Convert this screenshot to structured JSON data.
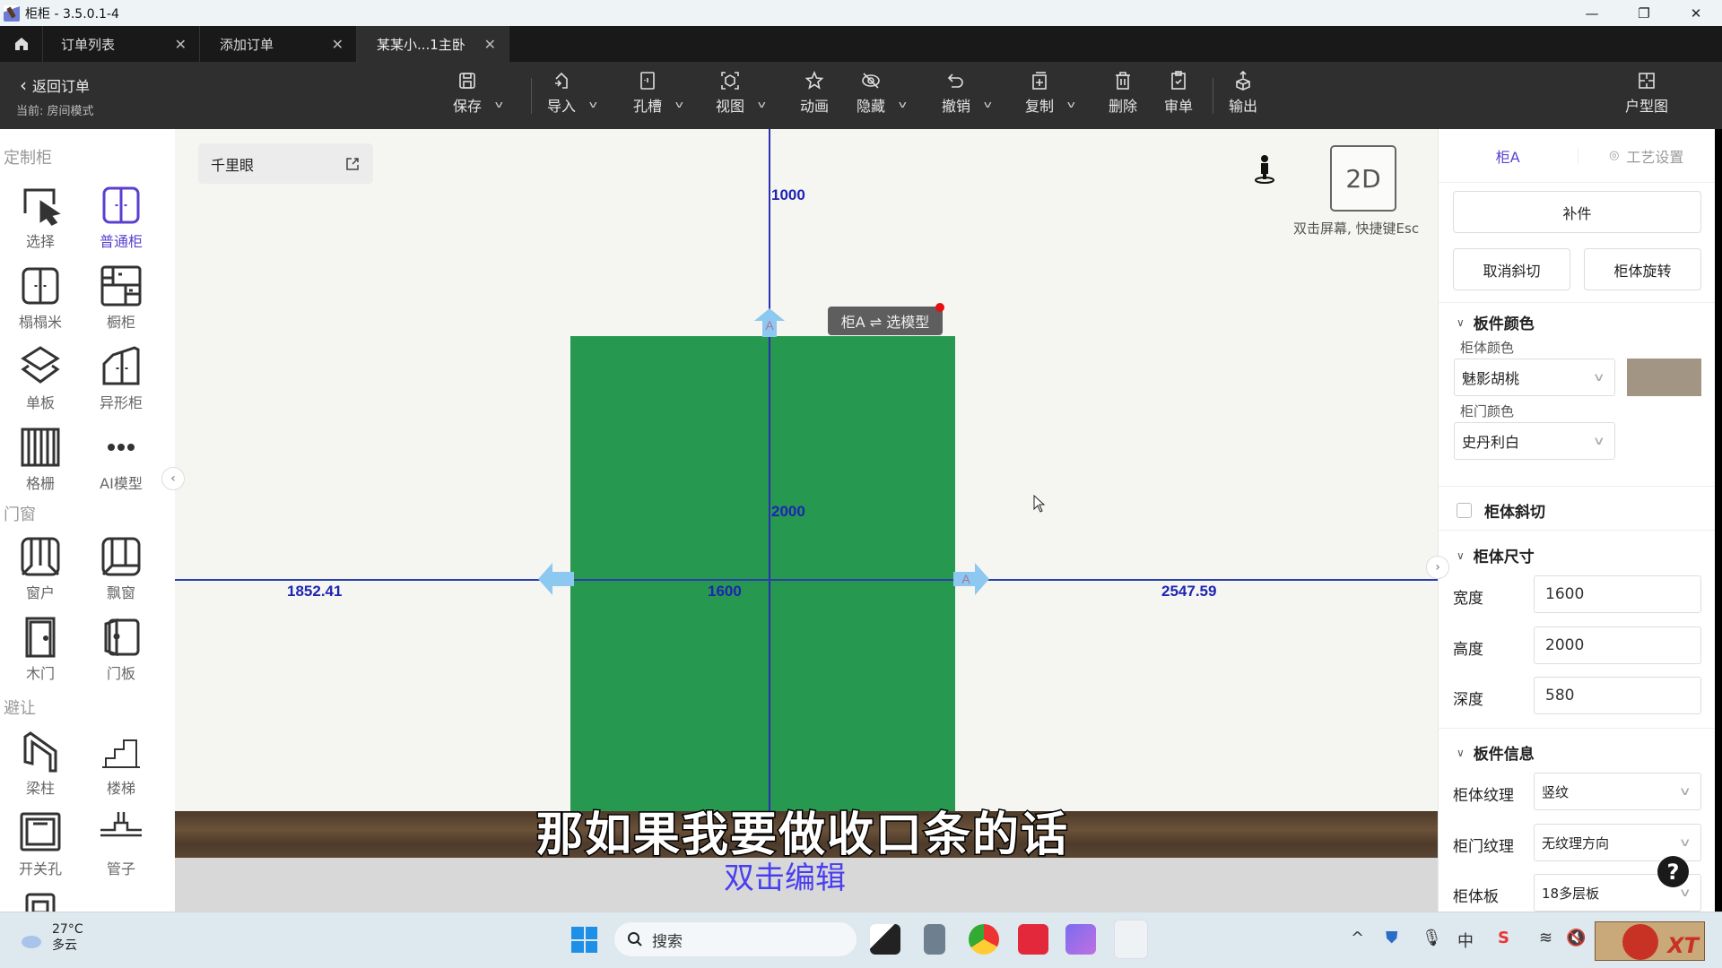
{
  "window": {
    "title": "柜柜 - 3.5.0.1-4",
    "controls": [
      "—",
      "❐",
      "✕"
    ]
  },
  "tabs": [
    {
      "label": "订单列表",
      "active": false
    },
    {
      "label": "添加订单",
      "active": false
    },
    {
      "label": "某某小...1主卧",
      "active": true
    }
  ],
  "toolbar": {
    "back_label": "返回订单",
    "current_mode": "当前: 房间模式",
    "items": [
      {
        "label": "保存",
        "icon": "save-icon",
        "dropdown": true
      },
      {
        "label": "导入",
        "icon": "import-icon",
        "dropdown": true
      },
      {
        "label": "孔槽",
        "icon": "slot-icon",
        "dropdown": true
      },
      {
        "label": "视图",
        "icon": "view-icon",
        "dropdown": true
      },
      {
        "label": "动画",
        "icon": "animation-icon",
        "dropdown": false
      },
      {
        "label": "隐藏",
        "icon": "hide-icon",
        "dropdown": true
      },
      {
        "label": "撤销",
        "icon": "undo-icon",
        "dropdown": true
      },
      {
        "label": "复制",
        "icon": "copy-icon",
        "dropdown": true
      },
      {
        "label": "删除",
        "icon": "delete-icon",
        "dropdown": false
      },
      {
        "label": "审单",
        "icon": "review-icon",
        "dropdown": false
      },
      {
        "label": "输出",
        "icon": "export-icon",
        "dropdown": false
      },
      {
        "label": "户型图",
        "icon": "floorplan-icon",
        "dropdown": false
      }
    ]
  },
  "left_panel": {
    "sections": [
      {
        "title": "定制柜",
        "items": [
          {
            "label": "选择",
            "icon": "select-icon"
          },
          {
            "label": "普通柜",
            "icon": "cabinet-icon",
            "selected": true
          },
          {
            "label": "榻榻米",
            "icon": "tatami-icon"
          },
          {
            "label": "橱柜",
            "icon": "kitchen-cabinet-icon"
          },
          {
            "label": "单板",
            "icon": "single-board-icon"
          },
          {
            "label": "异形柜",
            "icon": "shaped-cabinet-icon"
          },
          {
            "label": "格栅",
            "icon": "grille-icon"
          },
          {
            "label": "AI模型",
            "icon": "more-icon"
          }
        ]
      },
      {
        "title": "门窗",
        "items": [
          {
            "label": "窗户",
            "icon": "window-icon"
          },
          {
            "label": "飘窗",
            "icon": "bay-window-icon"
          },
          {
            "label": "木门",
            "icon": "wood-door-icon"
          },
          {
            "label": "门板",
            "icon": "door-panel-icon"
          }
        ]
      },
      {
        "title": "避让",
        "items": [
          {
            "label": "梁柱",
            "icon": "beam-icon"
          },
          {
            "label": "楼梯",
            "icon": "stairs-icon"
          },
          {
            "label": "开关孔",
            "icon": "switch-hole-icon"
          },
          {
            "label": "管子",
            "icon": "pipe-icon"
          }
        ]
      }
    ]
  },
  "canvas": {
    "minimap_label": "千里眼",
    "dim_top": "1000",
    "dim_height": "2000",
    "dim_left": "1852.41",
    "dim_width": "1600",
    "dim_right": "2547.59",
    "arrow_label": "A",
    "cabinet_tag": "柜A ⇌ 选模型",
    "view_button": "2D",
    "view_hint": "双击屏幕, 快捷键Esc",
    "edit_hint": "双击编辑",
    "subtitle": "那如果我要做收口条的话",
    "cabinet_color": "#27984f"
  },
  "right_panel": {
    "tabs": [
      {
        "label": "柜A",
        "active": true
      },
      {
        "label": "工艺设置",
        "active": false
      }
    ],
    "btn_parts": "补件",
    "btn_cancel_bevel": "取消斜切",
    "btn_rotate": "柜体旋转",
    "panel_color": {
      "title": "板件颜色",
      "body_label": "柜体颜色",
      "body_value": "魅影胡桃",
      "body_swatch": "#a29584",
      "door_label": "柜门颜色",
      "door_value": "史丹利白"
    },
    "bevel": {
      "label": "柜体斜切",
      "checked": false
    },
    "size": {
      "title": "柜体尺寸",
      "fields": [
        {
          "label": "宽度",
          "value": "1600"
        },
        {
          "label": "高度",
          "value": "2000"
        },
        {
          "label": "深度",
          "value": "580"
        }
      ]
    },
    "board_info": {
      "title": "板件信息",
      "fields": [
        {
          "label": "柜体纹理",
          "value": "竖纹"
        },
        {
          "label": "柜门纹理",
          "value": "无纹理方向"
        },
        {
          "label": "柜体板",
          "value": "18多层板"
        }
      ]
    },
    "help": "?"
  },
  "taskbar": {
    "weather_temp": "27°C",
    "weather_desc": "多云",
    "search_placeholder": "搜索",
    "apps": [
      "file-explorer",
      "calculator",
      "chrome",
      "video-app",
      "ai-app",
      "guigui-app"
    ],
    "tray": [
      "^",
      "security",
      "mic",
      "中",
      "S",
      "wifi",
      "mute"
    ]
  }
}
